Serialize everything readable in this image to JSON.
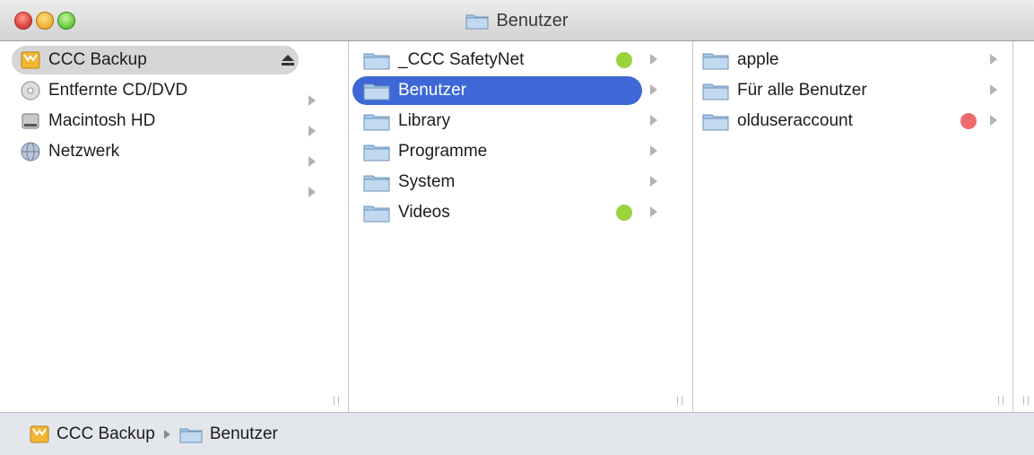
{
  "window": {
    "title": "Benutzer"
  },
  "sidebar": {
    "items": [
      {
        "label": "CCC Backup",
        "icon": "backup-disk-icon",
        "selected": true
      },
      {
        "label": "Entfernte CD/DVD",
        "icon": "cd-dvd-icon"
      },
      {
        "label": "Macintosh HD",
        "icon": "hard-drive-icon"
      },
      {
        "label": "Netzwerk",
        "icon": "network-globe-icon"
      }
    ]
  },
  "column2": {
    "items": [
      {
        "label": "_CCC SafetyNet",
        "tag": "green"
      },
      {
        "label": "Benutzer",
        "selected": true
      },
      {
        "label": "Library"
      },
      {
        "label": "Programme"
      },
      {
        "label": "System"
      },
      {
        "label": "Videos",
        "tag": "green"
      }
    ]
  },
  "column3": {
    "items": [
      {
        "label": "apple"
      },
      {
        "label": "Für alle Benutzer"
      },
      {
        "label": "olduseraccount",
        "tag": "red"
      }
    ]
  },
  "pathbar": {
    "items": [
      "CCC Backup",
      "Benutzer"
    ]
  },
  "colors": {
    "selection_blue": "#3d68d6",
    "tag_green": "#9bd33c",
    "tag_red": "#ee6b6b",
    "folder_blue": "#a9c8e8"
  }
}
